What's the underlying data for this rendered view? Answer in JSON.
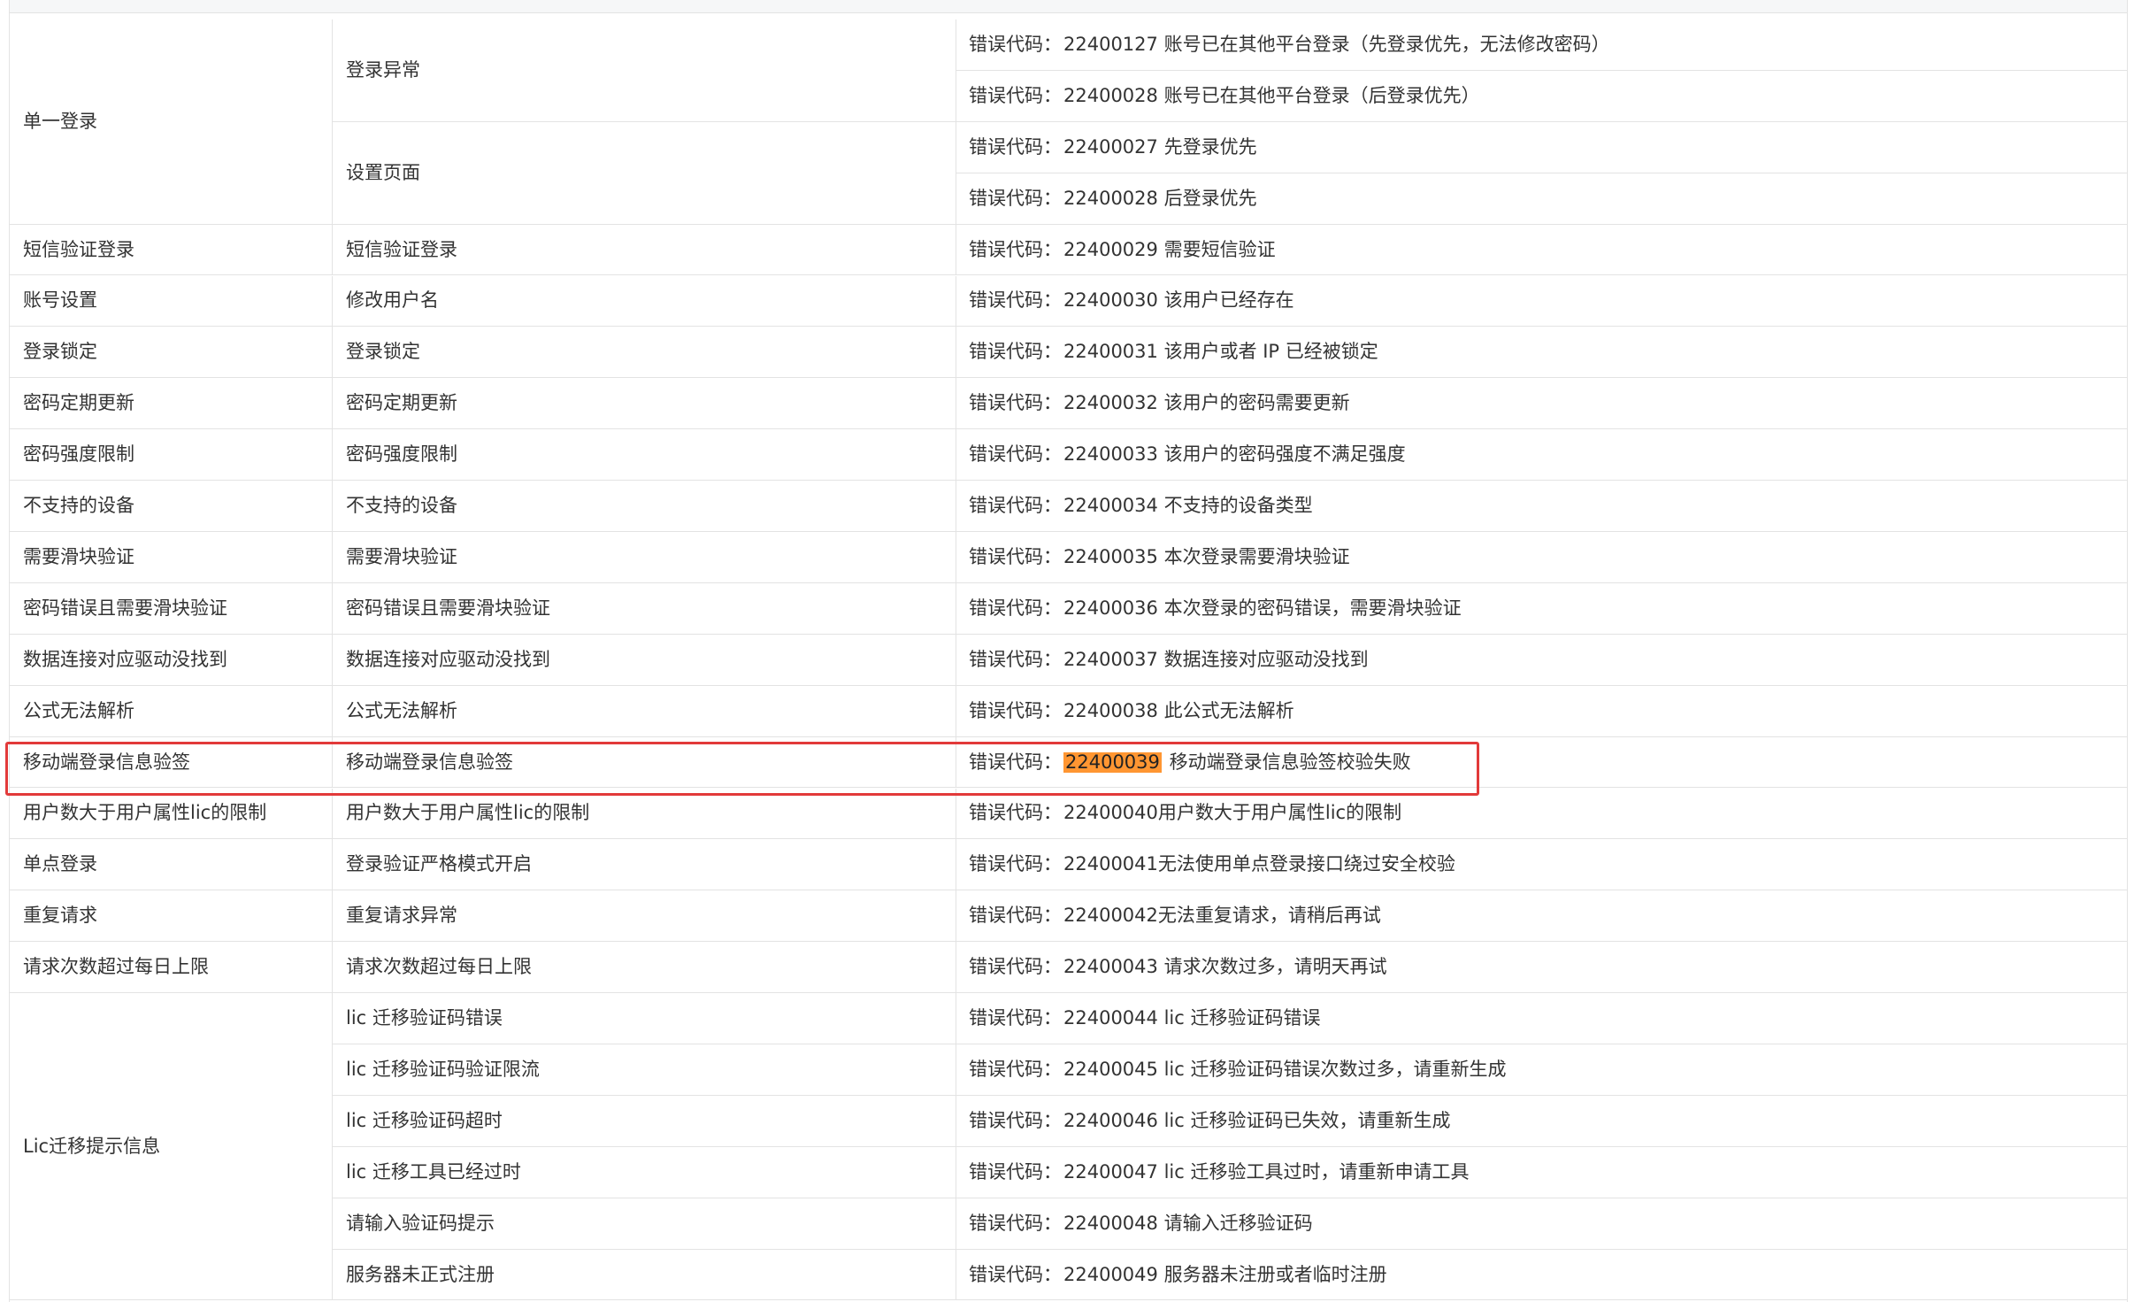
{
  "colors": {
    "border": "#e3e3e3",
    "text": "#333333",
    "highlight_box": "#e23a3a",
    "code_highlight": "#ff9632"
  },
  "top_partial_row": {
    "text": ""
  },
  "table": {
    "prefix": "错误代码：",
    "groups": [
      {
        "category": "单一登录",
        "scenes": [
          {
            "label": "登录异常",
            "errors": [
              {
                "code": "22400127",
                "message": " 账号已在其他平台登录（先登录优先，无法修改密码）"
              },
              {
                "code": "22400028",
                "message": " 账号已在其他平台登录（后登录优先）"
              }
            ]
          },
          {
            "label": "设置页面",
            "errors": [
              {
                "code": "22400027",
                "message": " 先登录优先"
              },
              {
                "code": "22400028",
                "message": " 后登录优先"
              }
            ]
          }
        ]
      },
      {
        "category": "短信验证登录",
        "scenes": [
          {
            "label": "短信验证登录",
            "errors": [
              {
                "code": "22400029",
                "message": " 需要短信验证"
              }
            ]
          }
        ]
      },
      {
        "category": "账号设置",
        "scenes": [
          {
            "label": "修改用户名",
            "errors": [
              {
                "code": "22400030",
                "message": " 该用户已经存在"
              }
            ]
          }
        ]
      },
      {
        "category": "登录锁定",
        "scenes": [
          {
            "label": "登录锁定",
            "errors": [
              {
                "code": "22400031",
                "message": " 该用户或者 IP 已经被锁定"
              }
            ]
          }
        ]
      },
      {
        "category": "密码定期更新",
        "scenes": [
          {
            "label": "密码定期更新",
            "errors": [
              {
                "code": "22400032",
                "message": " 该用户的密码需要更新"
              }
            ]
          }
        ]
      },
      {
        "category": "密码强度限制",
        "scenes": [
          {
            "label": "密码强度限制",
            "errors": [
              {
                "code": "22400033",
                "message": " 该用户的密码强度不满足强度"
              }
            ]
          }
        ]
      },
      {
        "category": "不支持的设备",
        "scenes": [
          {
            "label": "不支持的设备",
            "errors": [
              {
                "code": "22400034",
                "message": " 不支持的设备类型"
              }
            ]
          }
        ]
      },
      {
        "category": "需要滑块验证",
        "scenes": [
          {
            "label": "需要滑块验证",
            "errors": [
              {
                "code": "22400035",
                "message": " 本次登录需要滑块验证"
              }
            ]
          }
        ]
      },
      {
        "category": "密码错误且需要滑块验证",
        "scenes": [
          {
            "label": "密码错误且需要滑块验证",
            "errors": [
              {
                "code": "22400036",
                "message": " 本次登录的密码错误，需要滑块验证"
              }
            ]
          }
        ]
      },
      {
        "category": "数据连接对应驱动没找到",
        "scenes": [
          {
            "label": "数据连接对应驱动没找到",
            "errors": [
              {
                "code": "22400037",
                "message": " 数据连接对应驱动没找到"
              }
            ]
          }
        ]
      },
      {
        "category": "公式无法解析",
        "scenes": [
          {
            "label": "公式无法解析",
            "errors": [
              {
                "code": "22400038",
                "message": " 此公式无法解析"
              }
            ]
          }
        ]
      },
      {
        "category": "移动端登录信息验签",
        "highlighted": true,
        "scenes": [
          {
            "label": "移动端登录信息验签",
            "errors": [
              {
                "code": "22400039",
                "message": " 移动端登录信息验签校验失败",
                "code_highlighted": true
              }
            ]
          }
        ]
      },
      {
        "category": "用户数大于用户属性lic的限制",
        "scenes": [
          {
            "label": "用户数大于用户属性lic的限制",
            "errors": [
              {
                "code": "22400040",
                "message": "用户数大于用户属性lic的限制"
              }
            ]
          }
        ]
      },
      {
        "category": "单点登录",
        "scenes": [
          {
            "label": "登录验证严格模式开启",
            "errors": [
              {
                "code": "22400041",
                "message": "无法使用单点登录接口绕过安全校验"
              }
            ]
          }
        ]
      },
      {
        "category": "重复请求",
        "scenes": [
          {
            "label": "重复请求异常",
            "errors": [
              {
                "code": "22400042",
                "message": "无法重复请求，请稍后再试"
              }
            ]
          }
        ]
      },
      {
        "category": "请求次数超过每日上限",
        "scenes": [
          {
            "label": "请求次数超过每日上限",
            "errors": [
              {
                "code": "22400043",
                "message": " 请求次数过多，请明天再试"
              }
            ]
          }
        ]
      },
      {
        "category": "Lic迁移提示信息",
        "scenes": [
          {
            "label": "lic 迁移验证码错误",
            "errors": [
              {
                "code": "22400044",
                "message": " lic 迁移验证码错误"
              }
            ]
          },
          {
            "label": "lic 迁移验证码验证限流",
            "errors": [
              {
                "code": "22400045",
                "message": " lic 迁移验证码错误次数过多，请重新生成"
              }
            ]
          },
          {
            "label": "lic 迁移验证码超时",
            "errors": [
              {
                "code": "22400046",
                "message": " lic 迁移验证码已失效，请重新生成"
              }
            ]
          },
          {
            "label": "lic 迁移工具已经过时",
            "errors": [
              {
                "code": "22400047",
                "message": " lic 迁移验工具过时，请重新申请工具"
              }
            ]
          },
          {
            "label": "请输入验证码提示",
            "errors": [
              {
                "code": "22400048",
                "message": " 请输入迁移验证码"
              }
            ]
          },
          {
            "label": "服务器未正式注册",
            "errors": [
              {
                "code": "22400049",
                "message": " 服务器未注册或者临时注册"
              }
            ]
          }
        ]
      }
    ]
  }
}
